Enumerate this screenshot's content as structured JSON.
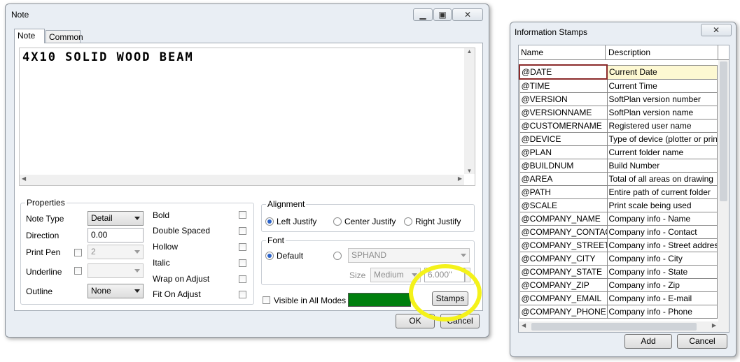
{
  "note_dialog": {
    "title": "Note",
    "tabs": [
      {
        "label": "Note"
      },
      {
        "label": "Common"
      }
    ],
    "note_text": "4X10 SOLID WOOD BEAM",
    "properties": {
      "group_label": "Properties",
      "note_type_label": "Note Type",
      "note_type_value": "Detail",
      "direction_label": "Direction",
      "direction_value": "0.00",
      "print_pen_label": "Print Pen",
      "print_pen_value": "2",
      "underline_label": "Underline",
      "underline_value": "",
      "outline_label": "Outline",
      "outline_value": "None",
      "bold_label": "Bold",
      "double_spaced_label": "Double Spaced",
      "hollow_label": "Hollow",
      "italic_label": "Italic",
      "wrap_on_adjust_label": "Wrap on Adjust",
      "fit_on_adjust_label": "Fit On Adjust"
    },
    "alignment": {
      "group_label": "Alignment",
      "left_label": "Left Justify",
      "center_label": "Center Justify",
      "right_label": "Right Justify",
      "selected": "left"
    },
    "font": {
      "group_label": "Font",
      "default_label": "Default",
      "font_name": "SPHAND",
      "size_label": "Size",
      "size_value": "Medium",
      "size_measure": "6.000''"
    },
    "visible_all_modes_label": "Visible in All Modes",
    "color_swatch": "#007f0e",
    "stamps_button": "Stamps",
    "ok_button": "OK",
    "cancel_button": "Cancel",
    "highlight_color": "#f4f21a"
  },
  "stamps_dialog": {
    "title": "Information Stamps",
    "columns": [
      "Name",
      "Description"
    ],
    "rows": [
      {
        "name": "@DATE",
        "desc": "Current Date"
      },
      {
        "name": "@TIME",
        "desc": "Current Time"
      },
      {
        "name": "@VERSION",
        "desc": "SoftPlan version number"
      },
      {
        "name": "@VERSIONNAME",
        "desc": "SoftPlan version name"
      },
      {
        "name": "@CUSTOMERNAME",
        "desc": "Registered user name"
      },
      {
        "name": "@DEVICE",
        "desc": "Type of device (plotter or printer"
      },
      {
        "name": "@PLAN",
        "desc": "Current folder name"
      },
      {
        "name": "@BUILDNUM",
        "desc": "Build Number"
      },
      {
        "name": "@AREA",
        "desc": "Total of all areas on drawing"
      },
      {
        "name": "@PATH",
        "desc": "Entire path of current folder"
      },
      {
        "name": "@SCALE",
        "desc": "Print scale being used"
      },
      {
        "name": "@COMPANY_NAME",
        "desc": "Company info - Name"
      },
      {
        "name": "@COMPANY_CONTACT",
        "desc": "Company info - Contact"
      },
      {
        "name": "@COMPANY_STREET",
        "desc": "Company info - Street address"
      },
      {
        "name": "@COMPANY_CITY",
        "desc": "Company info - City"
      },
      {
        "name": "@COMPANY_STATE",
        "desc": "Company info - State"
      },
      {
        "name": "@COMPANY_ZIP",
        "desc": "Company info - Zip"
      },
      {
        "name": "@COMPANY_EMAIL",
        "desc": "Company info - E-mail"
      },
      {
        "name": "@COMPANY_PHONE",
        "desc": "Company info - Phone"
      }
    ],
    "selected_row": 0,
    "add_button": "Add",
    "cancel_button": "Cancel"
  }
}
